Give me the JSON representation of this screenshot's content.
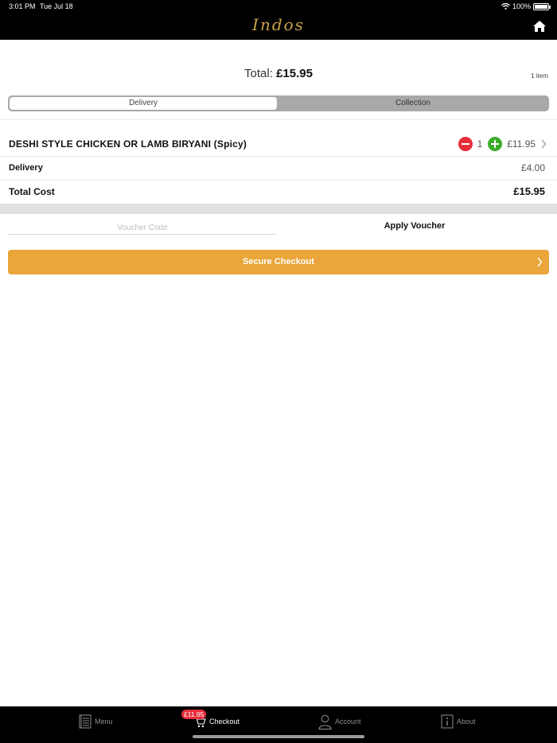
{
  "status_bar": {
    "time": "3:01 PM",
    "date": "Tue Jul 18",
    "battery": "100%"
  },
  "header": {
    "logo_text": "Indos",
    "home_icon": "home-icon"
  },
  "summary": {
    "total_label": "Total:",
    "total_value": "£15.95",
    "item_count": "1 item"
  },
  "order_type": {
    "options": [
      "Delivery",
      "Collection"
    ],
    "selected": "Delivery"
  },
  "cart": {
    "items": [
      {
        "name": "DESHI STYLE CHICKEN OR LAMB BIRYANI (Spicy)",
        "quantity": "1",
        "price": "£11.95"
      }
    ],
    "delivery_label": "Delivery",
    "delivery_value": "£4.00",
    "total_label": "Total Cost",
    "total_value": "£15.95"
  },
  "voucher": {
    "placeholder": "Voucher Code",
    "apply_label": "Apply Voucher"
  },
  "checkout": {
    "label": "Secure Checkout"
  },
  "tabs": {
    "menu": "Menu",
    "checkout": "Checkout",
    "checkout_badge": "£11.95",
    "account": "Account",
    "about": "About"
  },
  "colors": {
    "accent": "#eaa63a",
    "minus": "#e82d3b",
    "plus": "#3cab2a",
    "logo": "#c8a24a"
  }
}
